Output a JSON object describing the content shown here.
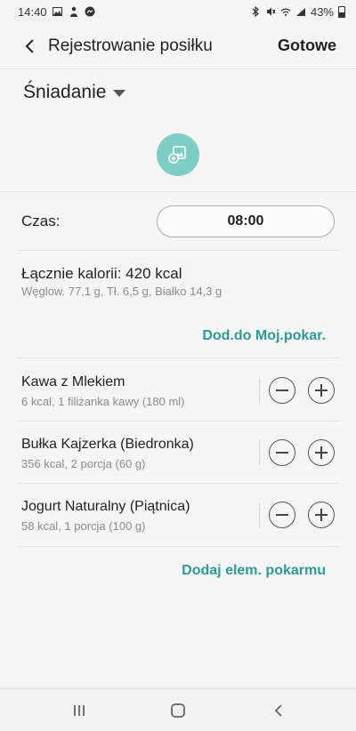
{
  "status": {
    "time": "14:40",
    "battery": "43%"
  },
  "header": {
    "title": "Rejestrowanie posiłku",
    "done_label": "Gotowe"
  },
  "meal": {
    "name": "Śniadanie"
  },
  "time_row": {
    "label": "Czas:",
    "value": "08:00"
  },
  "summary": {
    "total": "Łącznie kalorii: 420 kcal",
    "macros": "Węglow. 77,1 g, Tł. 6,5 g, Białko 14,3 g",
    "add_to_favorites": "Dod.do Moj.pokar."
  },
  "foods": [
    {
      "name": "Kawa z Mlekiem",
      "detail": "6 kcal, 1 filiżanka kawy (180 ml)"
    },
    {
      "name": "Bułka Kajzerka (Biedronka)",
      "detail": "356 kcal, 2 porcja (60 g)"
    },
    {
      "name": "Jogurt Naturalny (Piątnica)",
      "detail": "58 kcal, 1 porcja (100 g)"
    }
  ],
  "add_food_label": "Dodaj elem. pokarmu",
  "icons": {
    "back": "chevron-left-icon",
    "photo": "add-photo-icon",
    "minus": "minus-icon",
    "plus": "plus-icon",
    "nav_recents": "recents-icon",
    "nav_home": "home-icon",
    "nav_back": "back-icon"
  },
  "colors": {
    "accent": "#2b9b94",
    "photo_button": "#7ecdc4",
    "background": "#f5f5f5"
  }
}
